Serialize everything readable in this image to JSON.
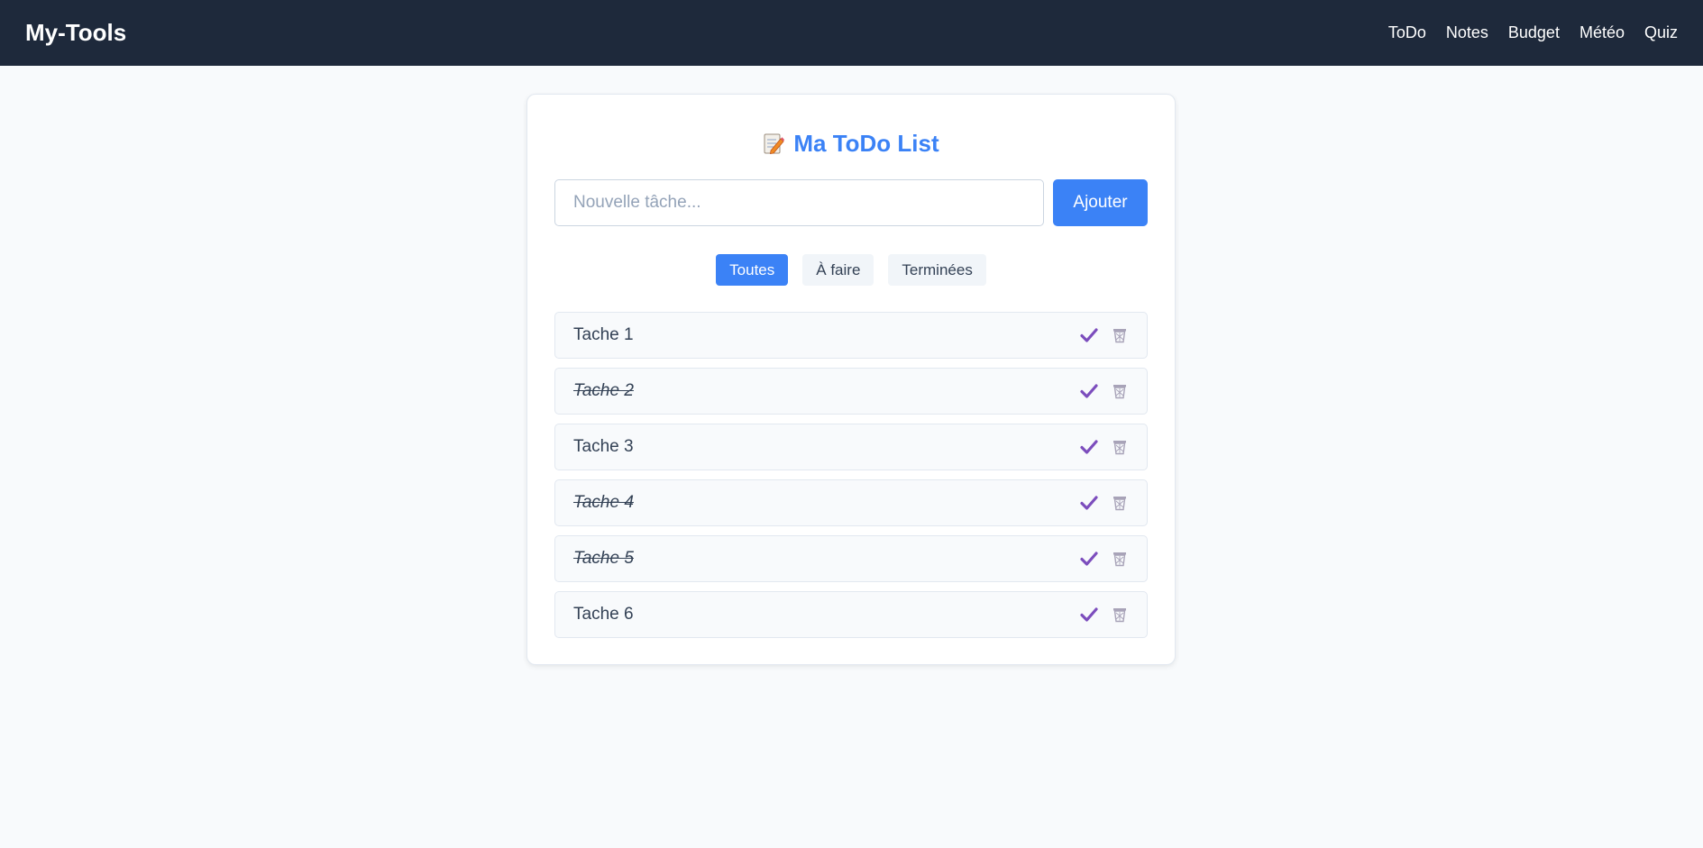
{
  "navbar": {
    "brand": "My-Tools",
    "links": [
      "ToDo",
      "Notes",
      "Budget",
      "Météo",
      "Quiz"
    ]
  },
  "main": {
    "title": "Ma ToDo List",
    "title_icon": "memo-icon",
    "input": {
      "placeholder": "Nouvelle tâche...",
      "value": ""
    },
    "add_label": "Ajouter",
    "filters": [
      {
        "label": "Toutes",
        "active": true
      },
      {
        "label": "À faire",
        "active": false
      },
      {
        "label": "Terminées",
        "active": false
      }
    ],
    "tasks": [
      {
        "label": "Tache 1",
        "done": false
      },
      {
        "label": "Tache 2",
        "done": true
      },
      {
        "label": "Tache 3",
        "done": false
      },
      {
        "label": "Tache 4",
        "done": true
      },
      {
        "label": "Tache 5",
        "done": true
      },
      {
        "label": "Tache 6",
        "done": false
      }
    ]
  },
  "colors": {
    "navbar": "#1e293b",
    "accent": "#3b82f6",
    "check": "#7c4dbd",
    "trash": "#a8a3b8"
  }
}
